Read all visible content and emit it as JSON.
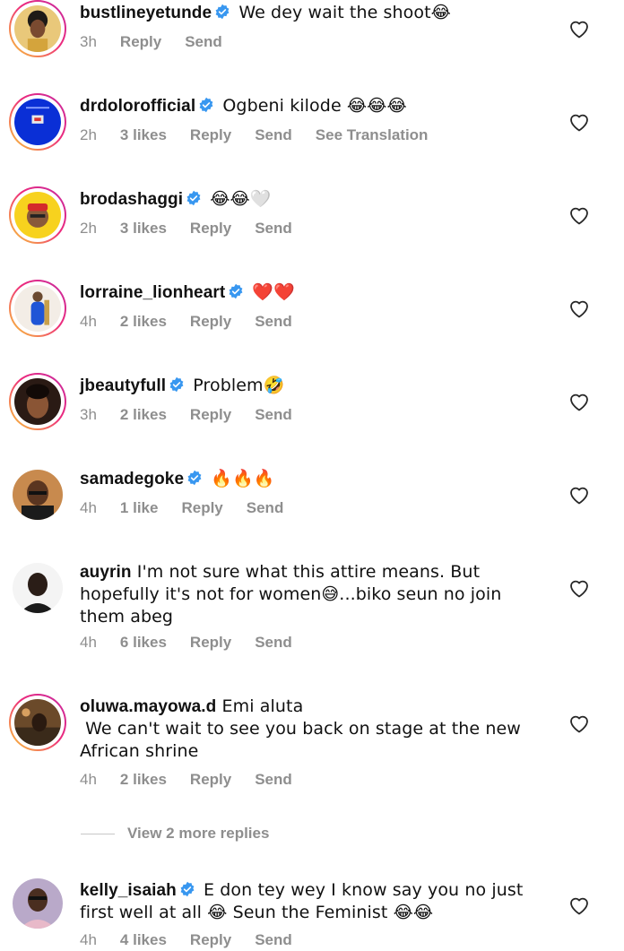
{
  "comments": [
    {
      "username": "bustlineyetunde",
      "verified": true,
      "text": " We dey wait the shoot😂",
      "time": "3h",
      "likes": "",
      "reply": "Reply",
      "send": "Send",
      "translate": "",
      "story_ring": true
    },
    {
      "username": "drdolorofficial",
      "verified": true,
      "text": " Ogbeni kilode 😂😂😂",
      "time": "2h",
      "likes": "3 likes",
      "reply": "Reply",
      "send": "Send",
      "translate": "See Translation",
      "story_ring": true
    },
    {
      "username": "brodashaggi",
      "verified": true,
      "text": " 😂😂🤍",
      "time": "2h",
      "likes": "3 likes",
      "reply": "Reply",
      "send": "Send",
      "translate": "",
      "story_ring": true
    },
    {
      "username": "lorraine_lionheart",
      "verified": true,
      "text": " ❤️❤️",
      "time": "4h",
      "likes": "2 likes",
      "reply": "Reply",
      "send": "Send",
      "translate": "",
      "story_ring": true
    },
    {
      "username": "jbeautyfull",
      "verified": true,
      "text": " Problem🤣",
      "time": "3h",
      "likes": "2 likes",
      "reply": "Reply",
      "send": "Send",
      "translate": "",
      "story_ring": true
    },
    {
      "username": "samadegoke",
      "verified": true,
      "text": " 🔥🔥🔥",
      "time": "4h",
      "likes": "1 like",
      "reply": "Reply",
      "send": "Send",
      "translate": "",
      "story_ring": false
    },
    {
      "username": "auyrin",
      "verified": false,
      "text": " I'm not sure what this attire means. But hopefully it's not for women😅...biko seun no join them abeg",
      "time": "4h",
      "likes": "6 likes",
      "reply": "Reply",
      "send": "Send",
      "translate": "",
      "story_ring": false
    },
    {
      "username": "oluwa.mayowa.d",
      "verified": false,
      "text": " Emi aluta\n We can't wait to see you back on stage at the new African shrine",
      "time": "4h",
      "likes": "2 likes",
      "reply": "Reply",
      "send": "Send",
      "translate": "",
      "story_ring": true
    },
    {
      "username": "kelly_isaiah",
      "verified": true,
      "text": " E don tey wey I know say you no just first well at all 😂 Seun the Feminist 😂😂",
      "time": "4h",
      "likes": "4 likes",
      "reply": "Reply",
      "send": "Send",
      "translate": "",
      "story_ring": false
    }
  ],
  "view_more_replies": "View 2 more replies",
  "colors": {
    "verified_badge": "#3897f0",
    "meta_text": "#8e8e8e",
    "text": "#111111"
  },
  "icons": {
    "like": "heart-outline-icon",
    "verified": "verified-badge-icon"
  }
}
